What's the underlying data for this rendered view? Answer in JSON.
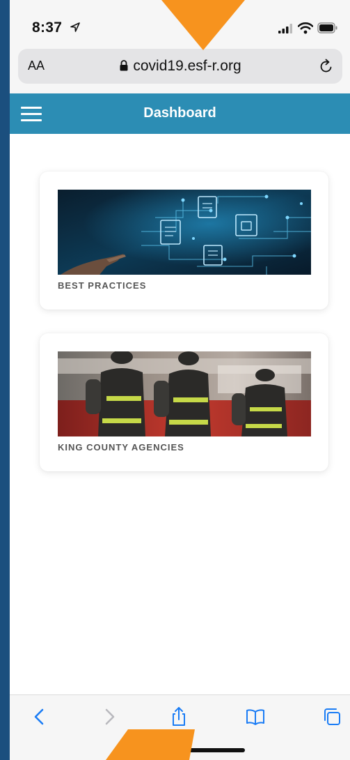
{
  "status_bar": {
    "time": "8:37"
  },
  "browser": {
    "text_size_label": "AA",
    "url": "covid19.esf-r.org"
  },
  "app": {
    "title": "Dashboard",
    "cards": [
      {
        "label": "BEST PRACTICES",
        "image": "circuit-board-documents"
      },
      {
        "label": "KING COUNTY AGENCIES",
        "image": "firefighters"
      }
    ]
  },
  "toolbar": {
    "icons": [
      "back-icon",
      "forward-icon",
      "share-icon",
      "bookmarks-icon",
      "tabs-icon"
    ]
  },
  "colors": {
    "appbar": "#2c8db4",
    "accent": "#1a7cf5",
    "pointer": "#f7931e",
    "frame": "#1b4f7e"
  }
}
